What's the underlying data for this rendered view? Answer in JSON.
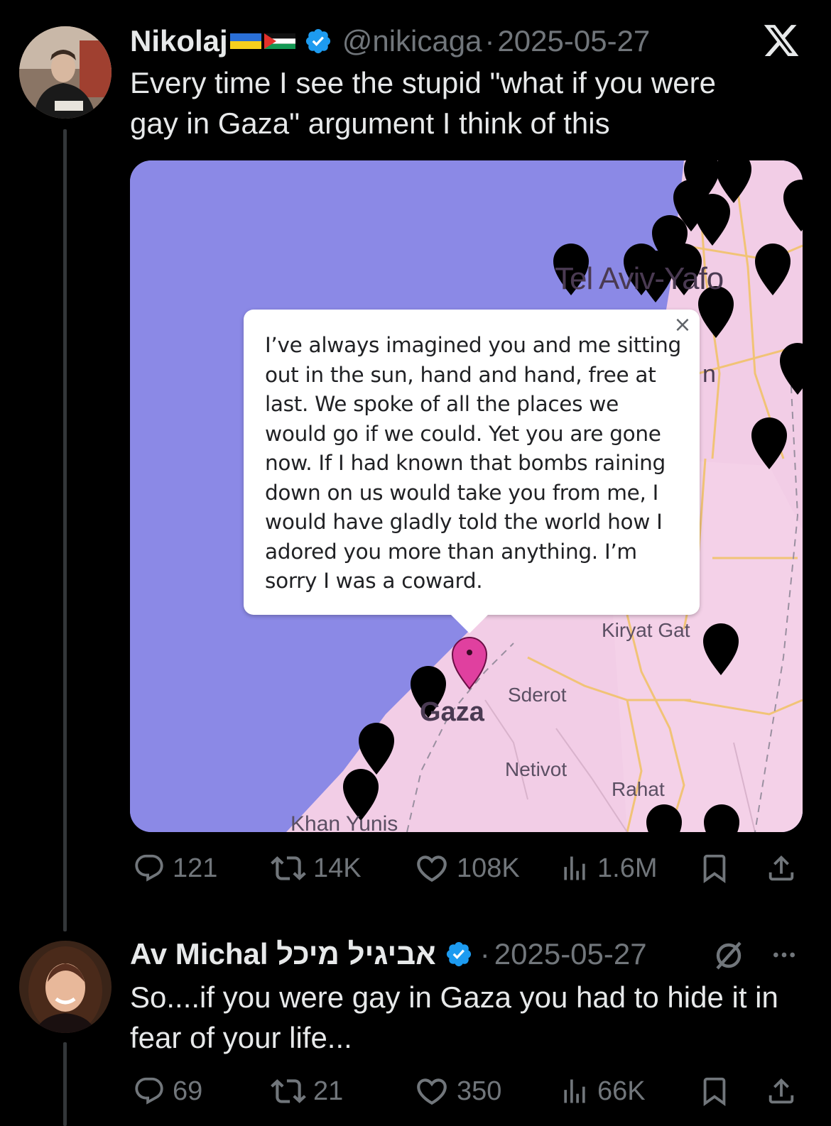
{
  "tweets": [
    {
      "name": "Nikolaj",
      "flags": "🇺🇦🇵🇸",
      "handle": "@nikicaga",
      "separator": "·",
      "date": "2025-05-27",
      "text": "Every time I see the stupid \"what if you were gay in Gaza\" argument I think of this",
      "stats": {
        "replies": "121",
        "reposts": "14K",
        "likes": "108K",
        "views": "1.6M"
      }
    },
    {
      "name": "Av Michal אביגיל מיכל",
      "separator": "·",
      "date": "2025-05-27",
      "text": "So....if you were gay in Gaza you had to hide it in fear of your life...",
      "stats": {
        "replies": "69",
        "reposts": "21",
        "likes": "350",
        "views": "66K"
      }
    }
  ],
  "map": {
    "popup_text": "I’ve always imagined you and me sitting out in the sun, hand and hand, free at last. We spoke of all the places we would go if we could. Yet you are gone now. If I had known that bombs raining down on us would take you from me, I would have gladly told the world how I adored you more than anything. I’m sorry I was a coward.",
    "popup_close": "×",
    "labels": {
      "tel_aviv": "Tel Aviv-Yafo",
      "kiryat_gat": "Kiryat Gat",
      "sderot": "Sderot",
      "gaza": "Gaza",
      "netivot": "Netivot",
      "rahat": "Rahat",
      "khan_yunis": "Khan Yunis",
      "partial_n": "n"
    }
  },
  "colors": {
    "background": "#000000",
    "text": "#e7e9ea",
    "muted": "#71767b",
    "verified": "#1d9bf0",
    "sea": "#8b89e6",
    "land": "#f2cde6",
    "pin_highlight": "#e0409f"
  },
  "icons": {
    "x_logo": "x-logo-icon",
    "reply": "reply-icon",
    "repost": "repost-icon",
    "like": "heart-icon",
    "views": "views-icon",
    "bookmark": "bookmark-icon",
    "share": "share-icon",
    "grok": "grok-icon",
    "more": "more-icon"
  }
}
